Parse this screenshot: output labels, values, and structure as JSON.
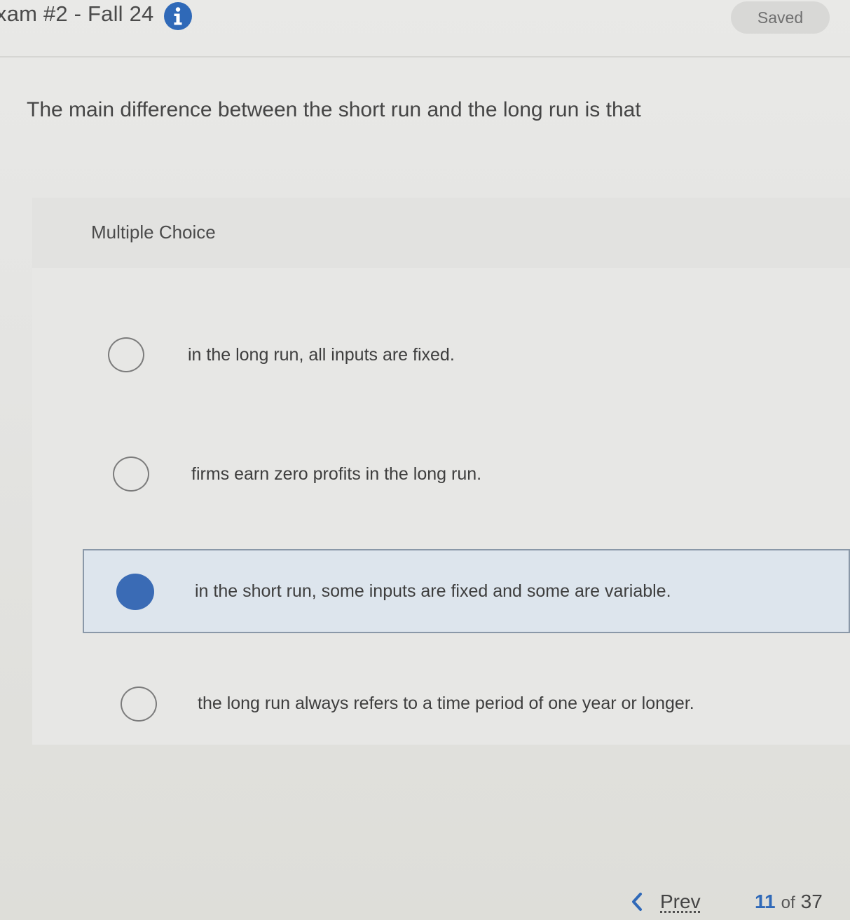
{
  "header": {
    "title": "xam #2 - Fall 24",
    "info_icon": "info-icon",
    "saved_label": "Saved"
  },
  "question": {
    "text": "The main difference between the short run and the long run is that",
    "type_label": "Multiple Choice",
    "options": [
      {
        "label": "in the long run, all inputs are fixed.",
        "selected": false
      },
      {
        "label": "firms earn zero profits in the long run.",
        "selected": false
      },
      {
        "label": "in the short run, some inputs are fixed and some are variable.",
        "selected": true
      },
      {
        "label": "the long run always refers to a time period of one year or longer.",
        "selected": false
      }
    ]
  },
  "footer": {
    "prev_label": "Prev",
    "prev_icon": "chevron-left-icon",
    "current_page": "11",
    "of_label": "of",
    "total_pages": "37"
  },
  "colors": {
    "accent": "#2f69b8",
    "selected_bg": "#dde5ed",
    "selected_radio": "#3a6bb5"
  }
}
